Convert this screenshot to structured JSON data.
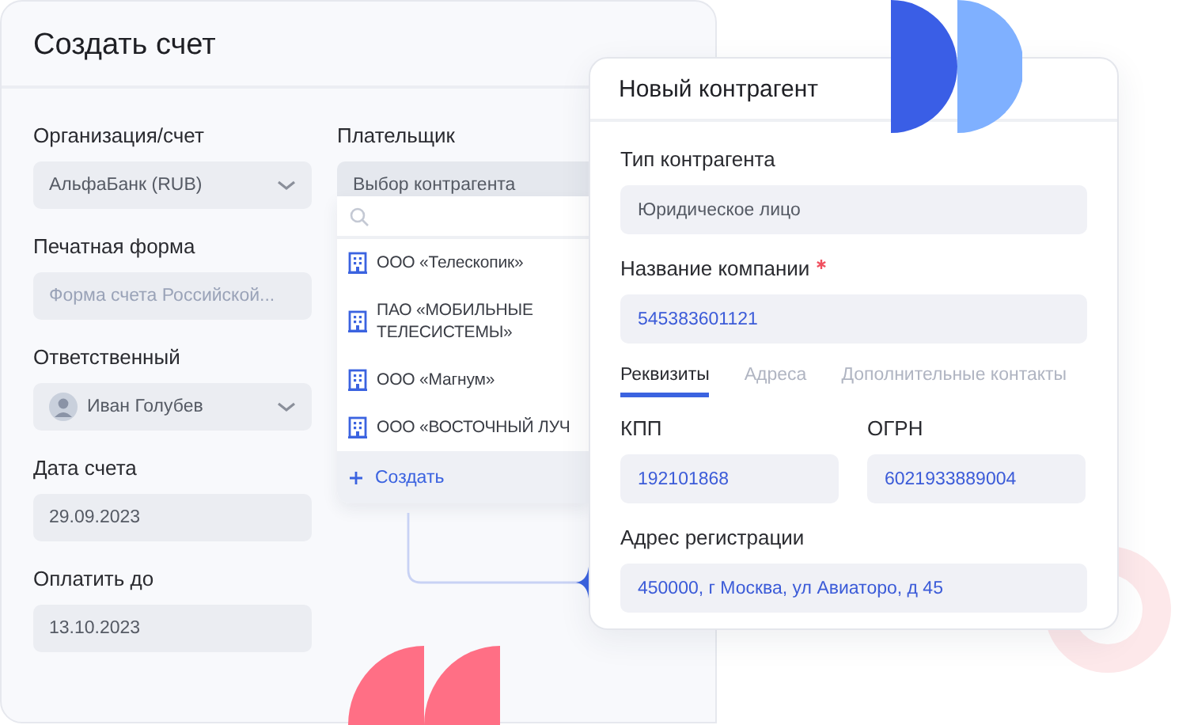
{
  "invoice_form": {
    "title": "Создать счет",
    "fields": [
      {
        "kind": "select",
        "label": "Организация/счет",
        "value": "АльфаБанк (RUB)"
      },
      {
        "kind": "input",
        "label": "Печатная форма",
        "placeholder": "Форма счета Российской..."
      },
      {
        "kind": "person",
        "label": "Ответственный",
        "value": "Иван Голубев"
      },
      {
        "kind": "input",
        "label": "Дата счета",
        "value": "29.09.2023"
      },
      {
        "kind": "input",
        "label": "Оплатить до",
        "value": "13.10.2023"
      }
    ],
    "payer": {
      "label": "Плательщик",
      "value": "Выбор контрагента",
      "options": [
        {
          "name": "ООО «Телескопик»"
        },
        {
          "name": "ПАО «МОБИЛЬНЫЕ ТЕЛЕСИСТЕМЫ»"
        },
        {
          "name": "ООО «Магнум»"
        },
        {
          "name": "ООО «ВОСТОЧНЫЙ ЛУЧ"
        }
      ],
      "create": "Создать"
    }
  },
  "new_counterparty": {
    "title": "Новый контрагент",
    "type": {
      "label": "Тип контрагента",
      "value": "Юридическое лицо"
    },
    "company": {
      "label": "Название компании",
      "required": true,
      "value": "545383601121"
    },
    "tabs": [
      {
        "label": "Реквизиты",
        "selected": true
      },
      {
        "label": "Адреса",
        "selected": false
      },
      {
        "label": "Дополнительные контакты",
        "selected": false
      }
    ],
    "kpp": {
      "label": "КПП",
      "value": "192101868"
    },
    "ogrn": {
      "label": "ОГРН",
      "value": "6021933889004"
    },
    "address": {
      "label": "Адрес регистрации",
      "value": "450000, г Москва, ул Авиаторо, д 45"
    }
  }
}
